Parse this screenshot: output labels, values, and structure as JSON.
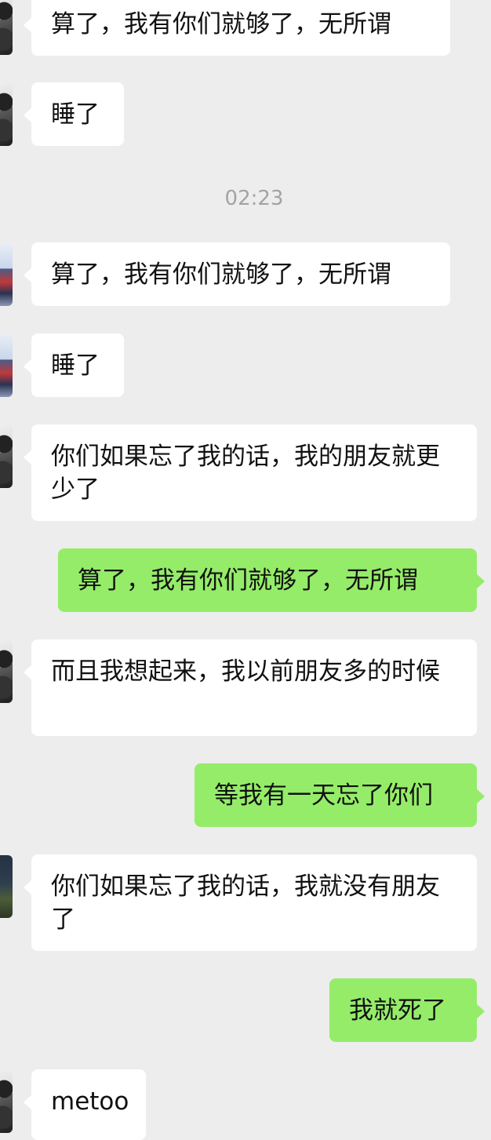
{
  "timestamp": "02:23",
  "colors": {
    "background": "#ededed",
    "incoming_bubble": "#ffffff",
    "outgoing_bubble": "#95ec69"
  },
  "messages": [
    {
      "side": "left",
      "text": "算了，我有你们就够了，无所谓",
      "avatar": "panda-avatar"
    },
    {
      "side": "left",
      "text": "睡了",
      "avatar": "panda-avatar"
    },
    {
      "side": "left",
      "text": "算了，我有你们就够了，无所谓",
      "avatar": "photo-avatar"
    },
    {
      "side": "left",
      "text": "睡了",
      "avatar": "photo-avatar"
    },
    {
      "side": "left",
      "text": "你们如果忘了我的话，我的朋友就更少了",
      "avatar": "panda-avatar"
    },
    {
      "side": "right",
      "text": "算了，我有你们就够了，无所谓"
    },
    {
      "side": "left",
      "text": "而且我想起来，我以前朋友多的时候",
      "avatar": "panda-avatar"
    },
    {
      "side": "right",
      "text": "等我有一天忘了你们"
    },
    {
      "side": "left",
      "text": "你们如果忘了我的话，我就没有朋友了",
      "avatar": "tree-avatar"
    },
    {
      "side": "right",
      "text": "我就死了"
    },
    {
      "side": "left",
      "text": "metoo",
      "avatar": "panda-avatar"
    }
  ]
}
